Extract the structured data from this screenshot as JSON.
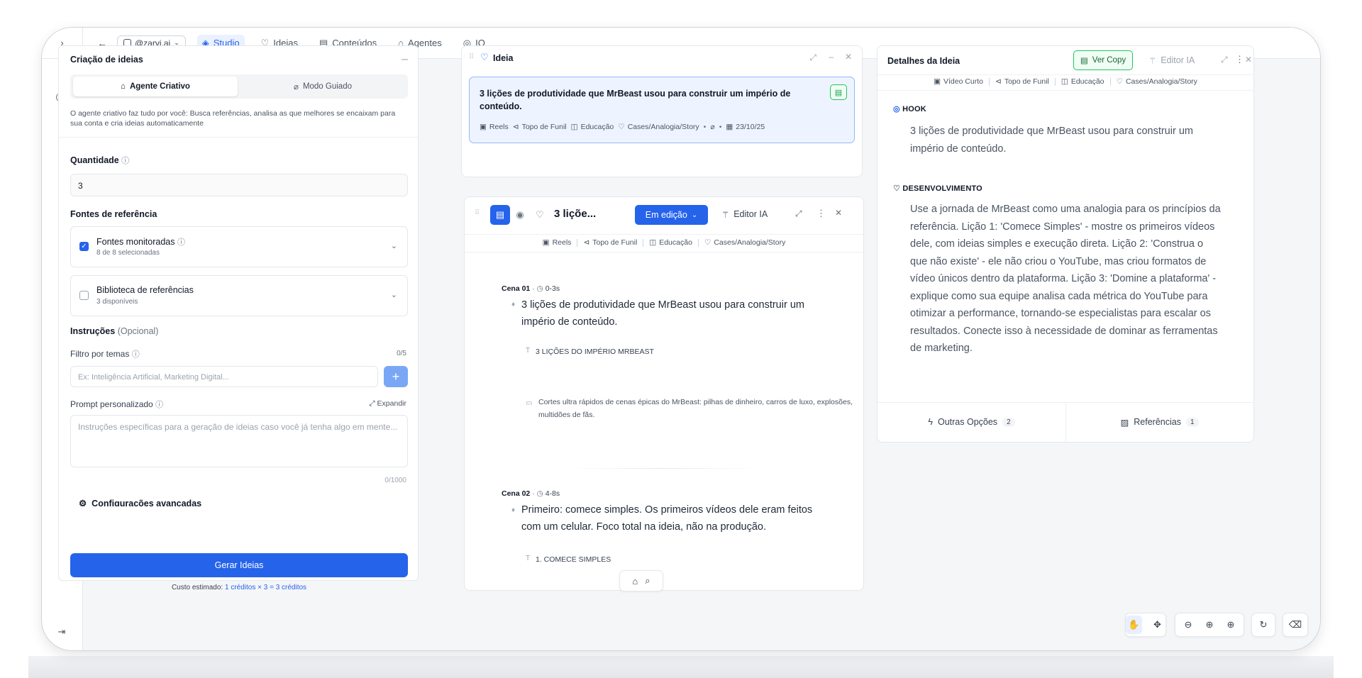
{
  "topbar": {
    "account": "@zarvi.ai",
    "nav": [
      {
        "label": "Studio",
        "icon": "layers-icon"
      },
      {
        "label": "Ideias",
        "icon": "lightbulb-icon"
      },
      {
        "label": "Conteúdos",
        "icon": "document-icon"
      },
      {
        "label": "Agentes",
        "icon": "bot-icon"
      },
      {
        "label": "IQ",
        "icon": "iq-icon"
      }
    ]
  },
  "colors": {
    "accent": "#2563eb",
    "accent_soft": "#eef4ff"
  },
  "left_panel": {
    "title": "Criação de ideias",
    "tabs": {
      "creative": "Agente Criativo",
      "guided": "Modo Guiado"
    },
    "description": "O agente criativo faz tudo por você: Busca referências, analisa as que melhores se encaixam para sua conta e cria ideias automaticamente",
    "quantity_label": "Quantidade",
    "quantity_value": "3",
    "sources_label": "Fontes de referência",
    "sources": [
      {
        "title": "Fontes monitoradas",
        "subtitle": "8 de 8 selecionadas",
        "checked": true
      },
      {
        "title": "Biblioteca de referências",
        "subtitle": "3 disponíveis",
        "checked": false
      }
    ],
    "instructions_label": "Instruções",
    "instructions_optional": "(Opcional)",
    "topic_filter_label": "Filtro por temas",
    "topic_filter_count": "0/5",
    "topic_filter_placeholder": "Ex: Inteligência Artificial, Marketing Digital...",
    "prompt_label": "Prompt personalizado",
    "expand_label": "Expandir",
    "prompt_placeholder": "Instruções específicas para a geração de ideias caso você já tenha algo em mente...",
    "prompt_count": "0/1000",
    "advanced_label": "Configurações avançadas",
    "generate_label": "Gerar Ideias",
    "cost_prefix": "Custo estimado: ",
    "cost_value": "1 créditos × 3 = 3 créditos"
  },
  "idea_card": {
    "header": "Ideia",
    "title": "3 lições de produtividade que MrBeast usou para construir um império de conteúdo.",
    "tags": [
      "Reels",
      "Topo de Funil",
      "Educação",
      "Cases/Analogia/Story"
    ],
    "date": "23/10/25"
  },
  "editor": {
    "title": "3 liçõe...",
    "status": "Em edição",
    "ai_editor": "Editor IA",
    "tags": [
      "Reels",
      "Topo de Funil",
      "Educação",
      "Cases/Analogia/Story"
    ],
    "scenes": [
      {
        "label": "Cena 01",
        "time": "0-3s",
        "speech": "3 lições de produtividade que MrBeast usou para construir um império de conteúdo.",
        "caption": "3 LIÇÕES DO IMPÉRIO MRBEAST",
        "visual": "Cortes ultra rápidos de cenas épicas do MrBeast: pilhas de dinheiro, carros de luxo, explosões, multidões de fãs."
      },
      {
        "label": "Cena 02",
        "time": "4-8s",
        "speech": "Primeiro: comece simples. Os primeiros vídeos dele eram feitos com um celular. Foco total na ideia, não na produção.",
        "caption": "1. COMECE SIMPLES"
      }
    ]
  },
  "details": {
    "title": "Detalhes da Ideia",
    "view_copy": "Ver Copy",
    "ai_editor": "Editor IA",
    "tags": [
      "Vídeo Curto",
      "Topo de Funil",
      "Educação",
      "Cases/Analogia/Story"
    ],
    "hook_label": "HOOK",
    "hook_text": "3 lições de produtividade que MrBeast usou para construir um império de conteúdo.",
    "dev_label": "DESENVOLVIMENTO",
    "dev_text": "Use a jornada de MrBeast como uma analogia para os princípios da referência. Lição 1: 'Comece Simples' - mostre os primeiros vídeos dele, com ideias simples e execução direta. Lição 2: 'Construa o que não existe' - ele não criou o YouTube, mas criou formatos de vídeo únicos dentro da plataforma. Lição 3: 'Domine a plataforma' - explique como sua equipe analisa cada métrica do YouTube para otimizar a performance, tornando-se especialistas para escalar os resultados. Conecte isso à necessidade de dominar as ferramentas de marketing.",
    "other_options": "Outras Opções",
    "other_options_count": "2",
    "references": "Referências",
    "references_count": "1"
  }
}
